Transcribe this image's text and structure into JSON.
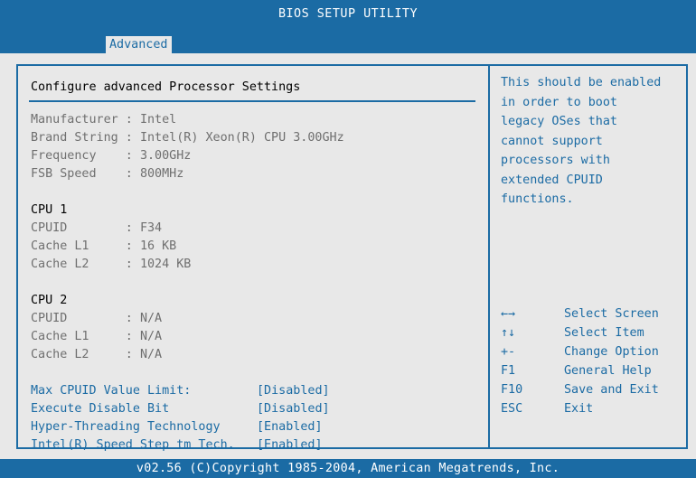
{
  "header": {
    "title": "BIOS SETUP UTILITY"
  },
  "tabs": [
    {
      "label": "Advanced"
    }
  ],
  "left": {
    "heading": "Configure advanced Processor Settings",
    "info": [
      {
        "label": "Manufacturer",
        "value": "Intel"
      },
      {
        "label": "Brand String",
        "value": "Intel(R) Xeon(R) CPU 3.00GHz"
      },
      {
        "label": "Frequency",
        "value": "3.00GHz"
      },
      {
        "label": "FSB Speed",
        "value": "800MHz"
      }
    ],
    "cpu1": {
      "title": "CPU 1",
      "rows": [
        {
          "label": "CPUID",
          "value": "F34"
        },
        {
          "label": "Cache L1",
          "value": "16 KB"
        },
        {
          "label": "Cache L2",
          "value": "1024 KB"
        }
      ]
    },
    "cpu2": {
      "title": "CPU 2",
      "rows": [
        {
          "label": "CPUID",
          "value": "N/A"
        },
        {
          "label": "Cache L1",
          "value": "N/A"
        },
        {
          "label": "Cache L2",
          "value": "N/A"
        }
      ]
    },
    "options": [
      {
        "label": "Max CPUID Value Limit:",
        "value": "[Disabled]"
      },
      {
        "label": "Execute Disable Bit",
        "value": "[Disabled]"
      },
      {
        "label": "Hyper-Threading Technology",
        "value": "[Enabled]"
      },
      {
        "label": "Intel(R) Speed Step tm Tech.",
        "value": "[Enabled]"
      }
    ]
  },
  "help": {
    "text": "This should be enabled\nin order to boot\nlegacy OSes that\ncannot support\nprocessors with\nextended CPUID\nfunctions."
  },
  "keys": [
    {
      "key": "←→",
      "action": "Select Screen",
      "icon": "left-right-arrows-icon"
    },
    {
      "key": "↑↓",
      "action": "Select Item",
      "icon": "up-down-arrows-icon"
    },
    {
      "key": "+-",
      "action": "Change Option"
    },
    {
      "key": "F1",
      "action": "General Help"
    },
    {
      "key": "F10",
      "action": "Save and Exit"
    },
    {
      "key": "ESC",
      "action": "Exit"
    }
  ],
  "footer": {
    "text": "v02.56 (C)Copyright 1985-2004, American Megatrends, Inc."
  },
  "colors": {
    "accent": "#1b6ba4",
    "background": "#e8e8e8",
    "gray_text": "#6f6f6f"
  }
}
